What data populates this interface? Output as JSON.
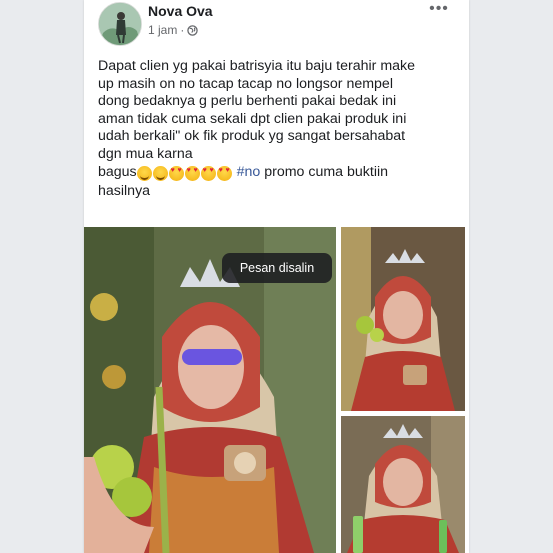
{
  "post": {
    "author": "Nova Ova",
    "timestamp": "1 jam",
    "separator": "·",
    "privacy_icon": "globe-icon",
    "more_icon": "more-horizontal-icon",
    "more_label": "•••",
    "text_lines": [
      "Dapat clien yg pakai batrisyia itu baju terahir make",
      "up masih on no tacap tacap no longsor nempel",
      "dong bedaknya g perlu berhenti pakai bedak ini",
      "aman tidak cuma sekali dpt clien pakai produk ini",
      "udah berkali\" ok fik produk yg sangat bersahabat",
      "dgn mua karna"
    ],
    "last_line_start": "bagus",
    "emojis": [
      "grinning-sweat-emoji",
      "grinning-sweat-emoji",
      "heart-eyes-emoji",
      "heart-eyes-emoji",
      "heart-eyes-emoji",
      "heart-eyes-emoji"
    ],
    "hashtag": "#no",
    "last_line_end": " promo cuma buktiin",
    "final_line": "hasilnya"
  },
  "toast": {
    "message": "Pesan disalin"
  },
  "colors": {
    "link": "#385898",
    "text": "#1c1e21",
    "secondary": "#65676b"
  }
}
